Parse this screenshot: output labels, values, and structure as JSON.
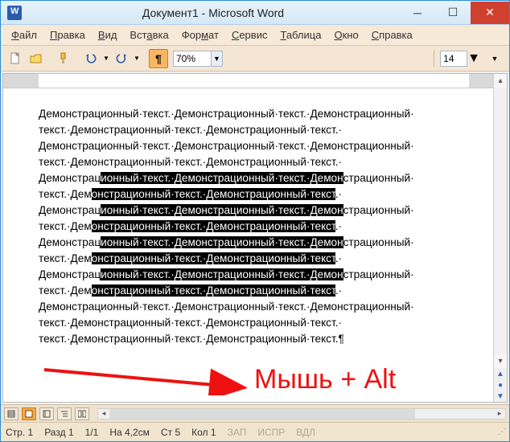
{
  "titlebar": {
    "title": "Документ1 - Microsoft Word"
  },
  "menu": {
    "file": "Файл",
    "edit": "Правка",
    "view": "Вид",
    "insert": "Вставка",
    "format": "Формат",
    "tools": "Сервис",
    "table": "Таблица",
    "window": "Окно",
    "help": "Справка"
  },
  "toolbar": {
    "zoom": "70%",
    "fontsize": "14"
  },
  "document": {
    "word": "Демонстрационный",
    "word2": "текст.",
    "sp": " "
  },
  "status": {
    "page_label": "Стр.",
    "page": "1",
    "section_label": "Разд",
    "section": "1",
    "pages": "1/1",
    "at_label": "На",
    "at": "4,2см",
    "line_label": "Ст",
    "line": "5",
    "col_label": "Кол",
    "col": "1",
    "rec": "ЗАП",
    "trk": "ИСПР",
    "ext": "ВДЛ"
  },
  "annotation": {
    "text": "Мышь + Alt"
  }
}
